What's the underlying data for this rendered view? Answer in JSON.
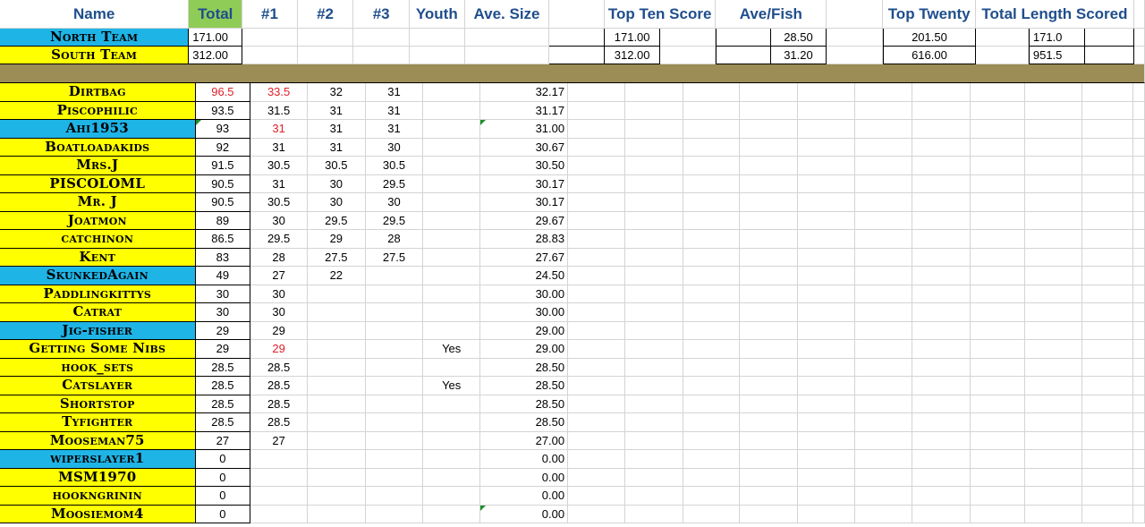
{
  "headers": {
    "name": "Name",
    "total": "Total",
    "n1": "#1",
    "n2": "#2",
    "n3": "#3",
    "youth": "Youth",
    "avg_size": "Ave. Size",
    "top_ten": "Top Ten Score",
    "ave_fish": "Ave/Fish",
    "top_twenty": "Top Twenty",
    "total_length": "Total Length Scored"
  },
  "teams": [
    {
      "name": "North Team",
      "total": "171.00",
      "top_ten": "171.00",
      "ave_fish": "28.50",
      "top_twenty": "201.50",
      "total_length": "171.0"
    },
    {
      "name": "South Team",
      "total": "312.00",
      "top_ten": "312.00",
      "ave_fish": "31.20",
      "top_twenty": "616.00",
      "total_length": "951.5"
    }
  ],
  "colors": {
    "yellow": "#ffff00",
    "blue": "#1fb4e6",
    "olive": "#9c8c55",
    "header_text": "#1f4e8c",
    "total_header_bg": "#8fcc57",
    "highlight_red": "#e0202a"
  },
  "players": [
    {
      "name": "Dirtbag",
      "color": "yellow",
      "total": "96.5",
      "n1": "33.5",
      "n2": "32",
      "n3": "31",
      "youth": "",
      "avg": "32.17",
      "red_total": true,
      "red_n1": true
    },
    {
      "name": "Piscophilic",
      "color": "yellow",
      "total": "93.5",
      "n1": "31.5",
      "n2": "31",
      "n3": "31",
      "youth": "",
      "avg": "31.17"
    },
    {
      "name": "Ahi1953",
      "color": "blue",
      "total": "93",
      "n1": "31",
      "n2": "31",
      "n3": "31",
      "youth": "",
      "avg": "31.00",
      "red_n1": true,
      "flag_total": true,
      "flag_avg": true
    },
    {
      "name": "Boatloadakids",
      "color": "yellow",
      "total": "92",
      "n1": "31",
      "n2": "31",
      "n3": "30",
      "youth": "",
      "avg": "30.67"
    },
    {
      "name": "Mrs.J",
      "color": "yellow",
      "total": "91.5",
      "n1": "30.5",
      "n2": "30.5",
      "n3": "30.5",
      "youth": "",
      "avg": "30.50"
    },
    {
      "name": "PISCOLOML",
      "color": "yellow",
      "total": "90.5",
      "n1": "31",
      "n2": "30",
      "n3": "29.5",
      "youth": "",
      "avg": "30.17"
    },
    {
      "name": "Mr. J",
      "color": "yellow",
      "total": "90.5",
      "n1": "30.5",
      "n2": "30",
      "n3": "30",
      "youth": "",
      "avg": "30.17"
    },
    {
      "name": "Joatmon",
      "color": "yellow",
      "total": "89",
      "n1": "30",
      "n2": "29.5",
      "n3": "29.5",
      "youth": "",
      "avg": "29.67"
    },
    {
      "name": "catchinon",
      "color": "yellow",
      "total": "86.5",
      "n1": "29.5",
      "n2": "29",
      "n3": "28",
      "youth": "",
      "avg": "28.83"
    },
    {
      "name": "Kent",
      "color": "yellow",
      "total": "83",
      "n1": "28",
      "n2": "27.5",
      "n3": "27.5",
      "youth": "",
      "avg": "27.67"
    },
    {
      "name": "SkunkedAgain",
      "color": "blue",
      "total": "49",
      "n1": "27",
      "n2": "22",
      "n3": "",
      "youth": "",
      "avg": "24.50"
    },
    {
      "name": "Paddlingkittys",
      "color": "yellow",
      "total": "30",
      "n1": "30",
      "n2": "",
      "n3": "",
      "youth": "",
      "avg": "30.00"
    },
    {
      "name": "Catrat",
      "color": "yellow",
      "total": "30",
      "n1": "30",
      "n2": "",
      "n3": "",
      "youth": "",
      "avg": "30.00"
    },
    {
      "name": "Jig-fisher",
      "color": "blue",
      "total": "29",
      "n1": "29",
      "n2": "",
      "n3": "",
      "youth": "",
      "avg": "29.00"
    },
    {
      "name": "Getting Some Nibs",
      "color": "yellow",
      "total": "29",
      "n1": "29",
      "n2": "",
      "n3": "",
      "youth": "Yes",
      "avg": "29.00",
      "red_n1": true
    },
    {
      "name": "hook_sets",
      "color": "yellow",
      "total": "28.5",
      "n1": "28.5",
      "n2": "",
      "n3": "",
      "youth": "",
      "avg": "28.50"
    },
    {
      "name": "Catslayer",
      "color": "yellow",
      "total": "28.5",
      "n1": "28.5",
      "n2": "",
      "n3": "",
      "youth": "Yes",
      "avg": "28.50"
    },
    {
      "name": "Shortstop",
      "color": "yellow",
      "total": "28.5",
      "n1": "28.5",
      "n2": "",
      "n3": "",
      "youth": "",
      "avg": "28.50"
    },
    {
      "name": "Tyfighter",
      "color": "yellow",
      "total": "28.5",
      "n1": "28.5",
      "n2": "",
      "n3": "",
      "youth": "",
      "avg": "28.50"
    },
    {
      "name": "Mooseman75",
      "color": "yellow",
      "total": "27",
      "n1": "27",
      "n2": "",
      "n3": "",
      "youth": "",
      "avg": "27.00"
    },
    {
      "name": "wiperslayer1",
      "color": "blue",
      "total": "0",
      "n1": "",
      "n2": "",
      "n3": "",
      "youth": "",
      "avg": "0.00"
    },
    {
      "name": "MSM1970",
      "color": "yellow",
      "total": "0",
      "n1": "",
      "n2": "",
      "n3": "",
      "youth": "",
      "avg": "0.00"
    },
    {
      "name": "hookngrinin",
      "color": "yellow",
      "total": "0",
      "n1": "",
      "n2": "",
      "n3": "",
      "youth": "",
      "avg": "0.00"
    },
    {
      "name": "Moosiemom4",
      "color": "yellow",
      "total": "0",
      "n1": "",
      "n2": "",
      "n3": "",
      "youth": "",
      "avg": "0.00",
      "flag_avg": true
    }
  ]
}
